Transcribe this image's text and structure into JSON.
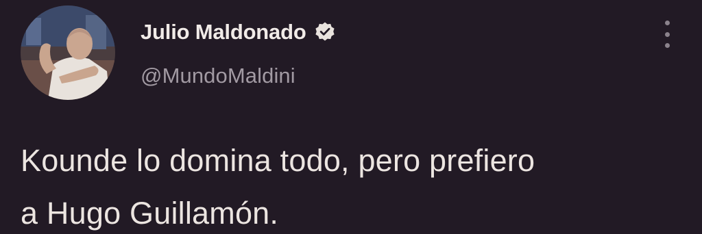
{
  "author": {
    "display_name": "Julio Maldonado",
    "handle": "@MundoMaldini",
    "verified": true,
    "avatar_icon": "profile-photo"
  },
  "tweet": {
    "text_line1": "Kounde lo domina todo, pero prefiero",
    "text_line2": "a Hugo Guillamón."
  },
  "icons": {
    "verified": "verified-badge-icon",
    "menu": "more-options-icon"
  },
  "colors": {
    "background": "#221a25",
    "text": "#ece5e1",
    "handle": "#a29aa3",
    "badge": "#e9e3de"
  }
}
